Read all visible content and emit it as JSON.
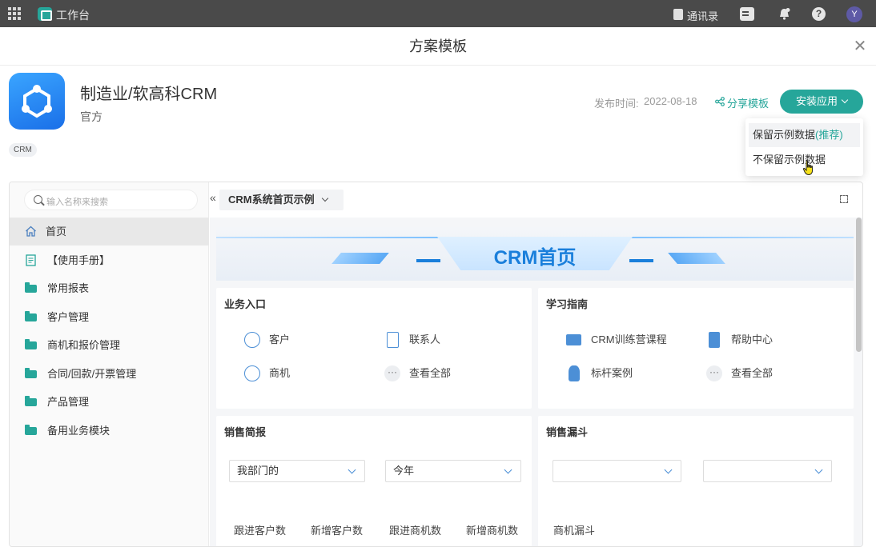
{
  "topbar": {
    "title": "工作台",
    "contacts_label": "通讯录",
    "avatar_initial": "Y"
  },
  "modal": {
    "title": "方案模板",
    "close_icon": "close-icon"
  },
  "app": {
    "name": "制造业/软高科CRM",
    "owner": "官方",
    "tag": "CRM",
    "publish_label": "发布时间:",
    "publish_date": "2022-08-18",
    "share_label": "分享模板",
    "install_label": "安装应用"
  },
  "dropdown": {
    "keep_label": "保留示例数据",
    "keep_recommend": "(推荐)",
    "discard_label": "不保留示例数据"
  },
  "preview": {
    "search_placeholder": "输入名称来搜索",
    "collapse_glyph": "«",
    "page_select": "CRM系统首页示例",
    "sidebar": [
      {
        "label": "首页",
        "icon": "home-icon"
      },
      {
        "label": "【使用手册】",
        "icon": "document-icon"
      },
      {
        "label": "常用报表",
        "icon": "folder-icon"
      },
      {
        "label": "客户管理",
        "icon": "folder-icon"
      },
      {
        "label": "商机和报价管理",
        "icon": "folder-icon"
      },
      {
        "label": "合同/回款/开票管理",
        "icon": "folder-icon"
      },
      {
        "label": "产品管理",
        "icon": "folder-icon"
      },
      {
        "label": "备用业务模块",
        "icon": "folder-icon"
      }
    ],
    "banner_title": "CRM首页",
    "business": {
      "title": "业务入口",
      "items": [
        "客户",
        "联系人",
        "商机",
        "查看全部"
      ]
    },
    "learning": {
      "title": "学习指南",
      "items": [
        "CRM训练营课程",
        "帮助中心",
        "标杆案例",
        "查看全部"
      ]
    },
    "sales_brief": {
      "title": "销售简报",
      "filter_dept": "我部门的",
      "filter_period": "今年",
      "stats": [
        "跟进客户数",
        "新增客户数",
        "跟进商机数",
        "新增商机数"
      ]
    },
    "sales_funnel": {
      "title": "销售漏斗",
      "filter_a": "",
      "filter_b": "",
      "stat": "商机漏斗"
    }
  },
  "colors": {
    "accent": "#26a69a",
    "link": "#4c8fd6",
    "banner": "#1a7fdb"
  }
}
